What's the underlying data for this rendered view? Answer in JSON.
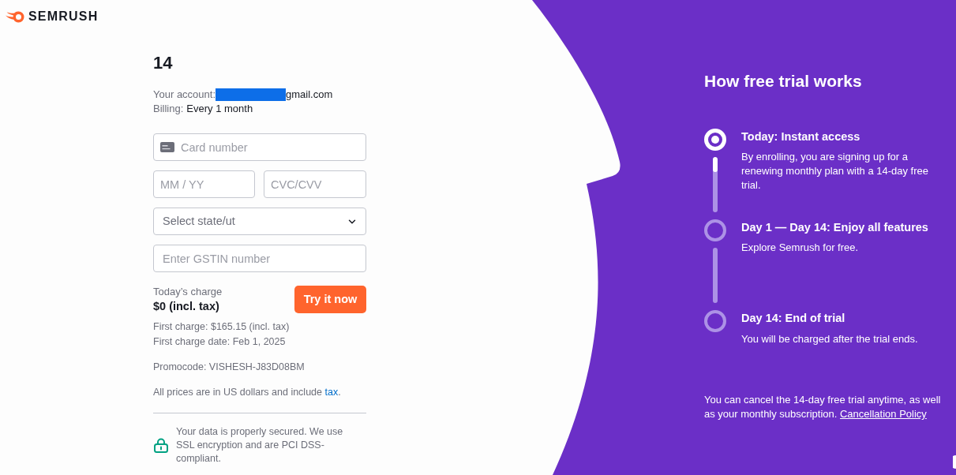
{
  "logo": {
    "text": "SEMRUSH"
  },
  "plan": {
    "title": "14",
    "account_label": "Your account:",
    "account_value": "gmail.com",
    "billing_label": "Billing:",
    "billing_value": "Every 1 month"
  },
  "form": {
    "card_number": {
      "placeholder": "Card number"
    },
    "expiry": {
      "placeholder": "MM / YY"
    },
    "cvc": {
      "placeholder": "CVC/CVV"
    },
    "state_select": {
      "placeholder": "Select state/ut"
    },
    "gstin": {
      "placeholder": "Enter GSTIN number"
    }
  },
  "charge": {
    "label": "Today’s charge",
    "amount": "$0 (incl. tax)",
    "button": "Try it now",
    "first_charge": "First charge: $165.15 (incl. tax)",
    "first_charge_date": "First charge date: Feb 1, 2025",
    "promocode": "Promocode: VISHESH-J83D08BM",
    "currency_note": {
      "before": "All prices are in US dollars and include",
      "link": "tax",
      "after": "."
    },
    "security_note": "Your data is properly secured. We use SSL encryption and are PCI DSS-compliant."
  },
  "trial": {
    "title": "How free trial works",
    "steps": [
      {
        "title": "Today: Instant access",
        "text": "By enrolling, you are signing up for a renewing monthly plan with a 14-day free trial.",
        "active": true,
        "level": 0.27
      },
      {
        "title": "Day 1 — Day 14: Enjoy all features",
        "text": "Explore Semrush for free.",
        "active": false
      },
      {
        "title": "Day 14: End of trial",
        "text": "You will be charged after the trial ends.",
        "active": false
      }
    ],
    "note": "You can cancel the 14-day free trial anytime, as well as your monthly subscription.",
    "note_link": "Cancellation Policy"
  }
}
